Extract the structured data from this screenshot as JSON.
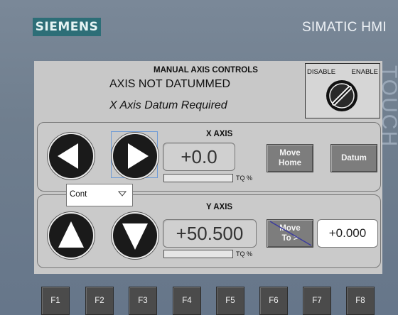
{
  "device": {
    "brand": "SIEMENS",
    "product": "SIMATIC HMI",
    "touch_label": "TOUCH"
  },
  "header": {
    "title": "MANUAL AXIS CONTROLS",
    "status_line1": "AXIS NOT DATUMMED",
    "status_line2": "X Axis Datum Required"
  },
  "key_switch": {
    "left_label": "DISABLE",
    "right_label": "ENABLE"
  },
  "x_axis": {
    "title": "X AXIS",
    "position": "+0.0",
    "torque_label": "TQ %",
    "torque_fraction": 0.0,
    "move_home_label": "Move\nHome",
    "datum_label": "Datum"
  },
  "mode_select": {
    "value": "Cont"
  },
  "y_axis": {
    "title": "Y AXIS",
    "position": "+50.500",
    "torque_label": "TQ %",
    "torque_fraction": 0.0,
    "move_to_label": "Move\nTo >",
    "target_value": "+0.000"
  },
  "function_keys": [
    "F1",
    "F2",
    "F3",
    "F4",
    "F5",
    "F6",
    "F7",
    "F8"
  ],
  "colors": {
    "bezel": "#6f7e8e",
    "brand_bg": "#2d6e77",
    "screen_bg": "#c8c8c8",
    "button_gray": "#7d7d7d",
    "fkey_bg": "#4b4b4b"
  }
}
